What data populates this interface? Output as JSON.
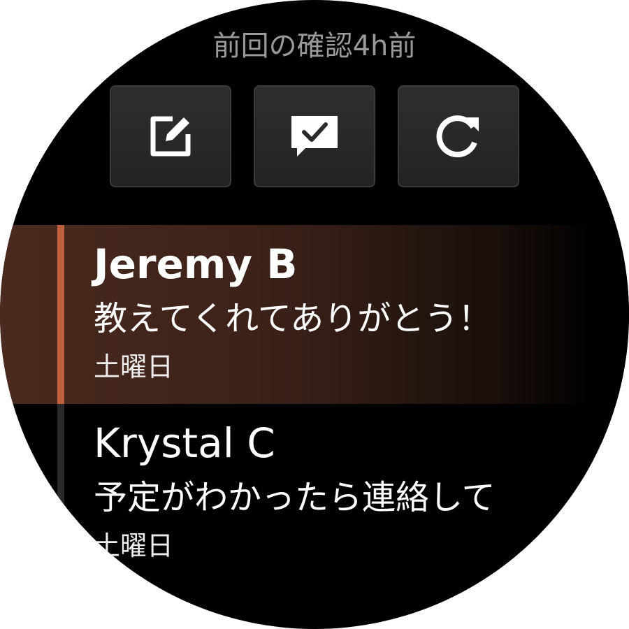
{
  "header": {
    "last_checked": "前回の確認4h前"
  },
  "actions": [
    {
      "icon": "compose-icon"
    },
    {
      "icon": "message-check-icon"
    },
    {
      "icon": "refresh-icon"
    }
  ],
  "messages": [
    {
      "sender": "Jeremy B",
      "preview": "教えてくれてありがとう！",
      "date": "土曜日",
      "selected": true
    },
    {
      "sender": "Krystal C",
      "preview": "予定がわかったら連絡して",
      "date": "土曜日",
      "selected": false
    }
  ],
  "colors": {
    "accent": "#c0603f",
    "background": "#000000",
    "muted_text": "#9a9a9a"
  }
}
